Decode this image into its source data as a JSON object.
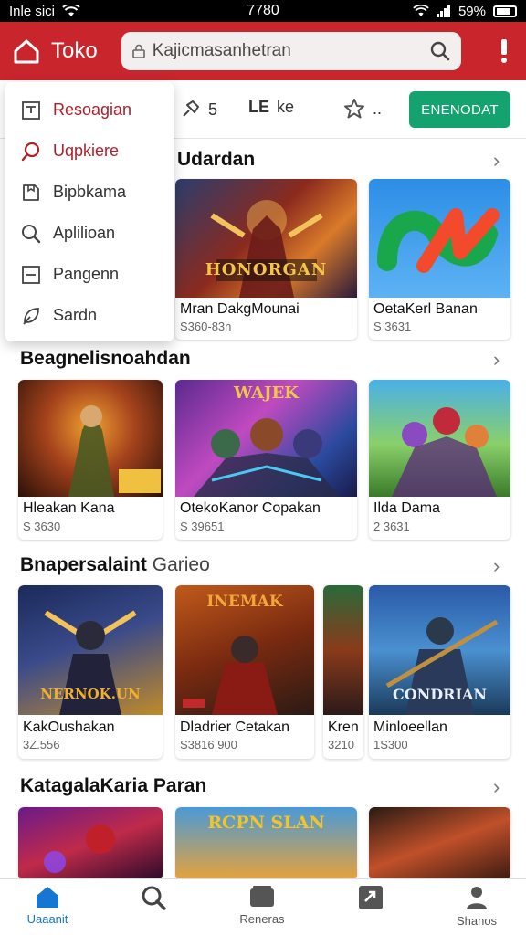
{
  "status_bar": {
    "carrier": "Inle sici",
    "time": "7780",
    "battery": "59%"
  },
  "header": {
    "brand": "Toko",
    "search_placeholder": "Kajicmasanhetran"
  },
  "toolbar": {
    "tool1_label": "5",
    "tool2_label": "ke",
    "tool2_prefix": "LE",
    "tool3_label": "..",
    "cta_label": "ENENODAT"
  },
  "menu": {
    "items": [
      {
        "label": "Resoagian",
        "icon": "list-icon"
      },
      {
        "label": "Uqpkiere",
        "icon": "search-red-icon"
      },
      {
        "label": "Bipbkama",
        "icon": "bookmark-icon"
      },
      {
        "label": "Aplilioan",
        "icon": "search-icon"
      },
      {
        "label": "Pangenn",
        "icon": "minus-box-icon"
      },
      {
        "label": "Sardn",
        "icon": "leaf-icon"
      }
    ]
  },
  "sections": [
    {
      "title": "Udardan",
      "title_suffix": "",
      "cards": [
        {
          "title": "Mran DakgMounai",
          "price": "S360-83n",
          "banner": "HONORGAN"
        },
        {
          "title": "OetaKerl Banan",
          "price": "S 3631",
          "banner": ""
        }
      ]
    },
    {
      "title": "Beagnelisnoahdan",
      "title_suffix": "",
      "cards": [
        {
          "title": "Hleakan Kana",
          "price": "S 3630",
          "banner": ""
        },
        {
          "title": "OtekoKanor Copakan",
          "price": "S 39651",
          "banner": "WAJEK"
        },
        {
          "title": "Ilda Dama",
          "price": "2 3631",
          "banner": ""
        }
      ]
    },
    {
      "title": "Bnapersalaint",
      "title_suffix": "Garieo",
      "cards": [
        {
          "title": "KakOushakan",
          "price": "3Z.556",
          "banner": "NERNOK.UN"
        },
        {
          "title": "Dladrier Cetakan",
          "price": "S3816 900",
          "banner": "INEMAK"
        },
        {
          "title": "Kren",
          "price": "3210",
          "banner": ""
        },
        {
          "title": "Minloeellan",
          "price": "1S300",
          "banner": "CONDRIAN"
        }
      ]
    },
    {
      "title": "KatagalaKaria Paran",
      "title_suffix": "",
      "cards": [
        {
          "title": "",
          "price": "",
          "banner": ""
        },
        {
          "title": "",
          "price": "",
          "banner": "RCPN SLAN"
        },
        {
          "title": "",
          "price": "",
          "banner": ""
        }
      ]
    }
  ],
  "bottom_nav": [
    {
      "label": "Uaaanit",
      "icon": "home-icon",
      "active": true
    },
    {
      "label": "",
      "icon": "search-icon",
      "active": false
    },
    {
      "label": "Reneras",
      "icon": "folder-icon",
      "active": false
    },
    {
      "label": "",
      "icon": "download-icon",
      "active": false
    },
    {
      "label": "Shanos",
      "icon": "profile-icon",
      "active": false
    }
  ],
  "colors": {
    "header": "#c8252d",
    "cta": "#14a36f",
    "nav_active": "#1677d2"
  }
}
